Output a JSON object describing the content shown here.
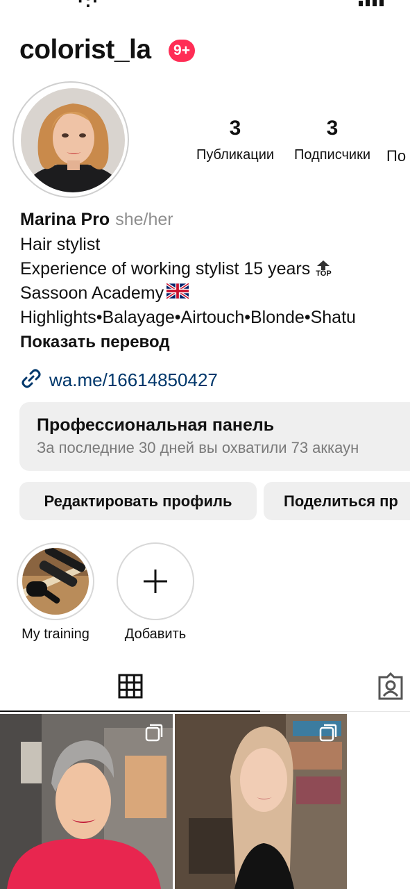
{
  "profile": {
    "username": "colorist_la",
    "notifications_badge": "9+",
    "stats": [
      {
        "value": "3",
        "label": "Публикации"
      },
      {
        "value": "3",
        "label": "Подписчики"
      },
      {
        "value": "",
        "label": "По"
      }
    ]
  },
  "bio": {
    "name": "Marina Pro",
    "pronouns": "she/her",
    "lines": [
      "Hair stylist",
      "Experience of working stylist 15 years",
      "Sassoon Academy",
      "Highlights•Balayage•Airtouch•Blonde•Shatu"
    ],
    "top_badge": "TOP",
    "show_translation": "Показать перевод",
    "link": "wa.me/16614850427"
  },
  "pro_panel": {
    "title": "Профессиональная панель",
    "subtitle": "За последние 30 дней вы охватили 73 аккаун"
  },
  "actions": {
    "edit_profile": "Редактировать профиль",
    "share_profile": "Поделиться пр"
  },
  "highlights": [
    {
      "label": "My training"
    },
    {
      "label": "Добавить"
    }
  ],
  "colors": {
    "badge": "#ff2d55",
    "link": "#00376b",
    "panel_bg": "#efefef",
    "secondary_text": "#8e8e8e"
  },
  "icons": {
    "verified_or_notification": "notification-badge",
    "link": "link-icon",
    "add_highlight": "plus-icon",
    "grid_tab": "grid-icon",
    "tagged_tab": "tagged-person-icon",
    "multi_post": "multiple-posts-icon",
    "flag": "uk-flag-icon"
  }
}
